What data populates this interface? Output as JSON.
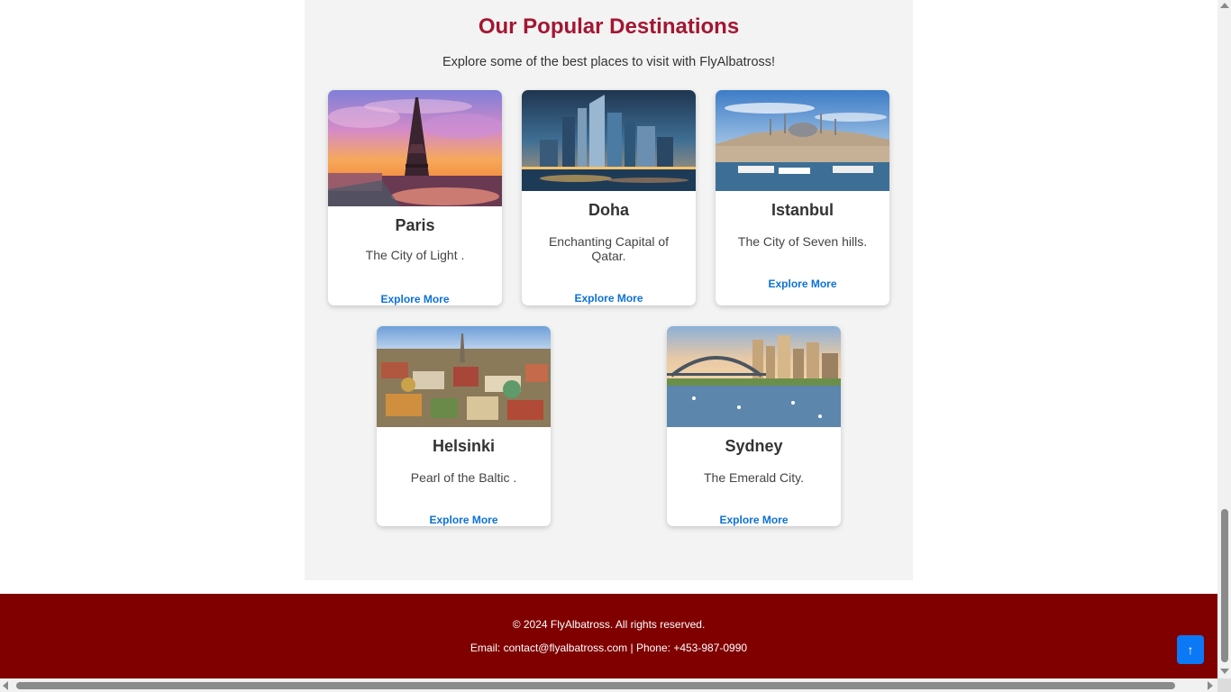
{
  "section": {
    "title": "Our Popular Destinations",
    "subtitle": "Explore some of the best places to visit with FlyAlbatross!"
  },
  "destinations": [
    {
      "name": "Paris",
      "description": "The City of Light .",
      "link": "Explore More",
      "image": "paris-eiffel-tower-sunset"
    },
    {
      "name": "Doha",
      "description": "Enchanting Capital of Qatar.",
      "link": "Explore More",
      "image": "doha-skyline-night"
    },
    {
      "name": "Istanbul",
      "description": "The City of Seven hills.",
      "link": "Explore More",
      "image": "istanbul-mosque-waterfront"
    },
    {
      "name": "Helsinki",
      "description": "Pearl of the Baltic .",
      "link": "Explore More",
      "image": "helsinki-aerial-city"
    },
    {
      "name": "Sydney",
      "description": "The Emerald City.",
      "link": "Explore More",
      "image": "sydney-harbour-bridge"
    }
  ],
  "footer": {
    "copyright": "© 2024 FlyAlbatross. All rights reserved.",
    "contact": "Email: contact@flyalbatross.com | Phone: +453-987-0990"
  },
  "back_to_top": {
    "icon": "arrow-up-icon",
    "glyph": "↑"
  },
  "colors": {
    "title": "#a31632",
    "link": "#0c71d8",
    "footer_bg": "#800000",
    "section_bg": "#f3f3f3",
    "back_to_top_bg": "#0b78f6"
  }
}
